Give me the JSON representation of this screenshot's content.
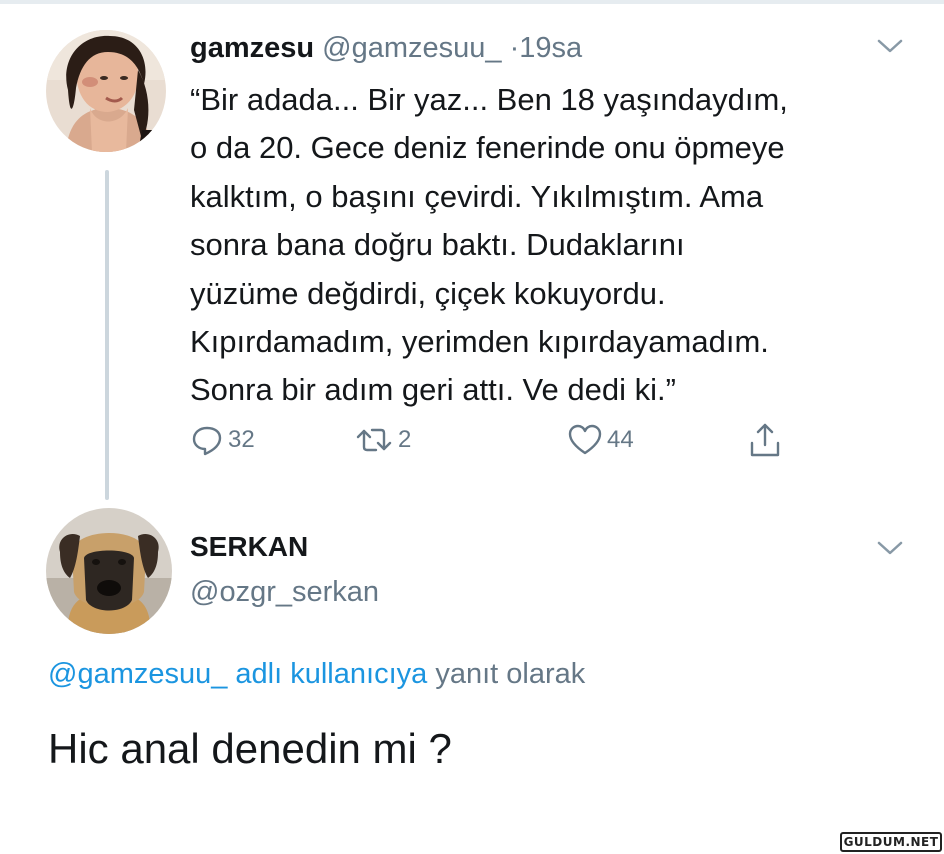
{
  "tweet1": {
    "display_name": "gamzesu",
    "handle": "@gamzesuu_",
    "separator": "·",
    "time": "19sa",
    "body_lines": [
      "“Bir adada... Bir yaz... Ben 18 yaşındaydım,",
      "o da 20. Gece deniz fenerinde onu öpmeye",
      "kalktım, o başını çevirdi. Yıkılmıştım. Ama",
      "sonra bana doğru baktı. Dudaklarını",
      "yüzüme değdirdi, çiçek kokuyordu.",
      "Kıpırdamadım, yerimden kıpırdayamadım.",
      "Sonra bir adım geri attı. Ve dedi ki.”"
    ],
    "actions": {
      "reply": {
        "icon": "reply-icon",
        "count": "32"
      },
      "retweet": {
        "icon": "retweet-icon",
        "count": "2"
      },
      "like": {
        "icon": "heart-icon",
        "count": "44"
      },
      "share": {
        "icon": "share-icon"
      }
    },
    "menu_icon": "chevron-down-icon"
  },
  "tweet2": {
    "display_name": "SERKAN",
    "handle": "@ozgr_serkan",
    "reply_to": {
      "link_text": "@gamzesuu_ adlı kullanıcıya",
      "rest_text": "yanıt olarak"
    },
    "body": "Hic anal denedin mi ?",
    "menu_icon": "chevron-down-icon"
  },
  "watermark": "GULDUM.NET",
  "colors": {
    "text": "#14171a",
    "secondary": "#657786",
    "link": "#1b95e0",
    "thread_line": "#ccd6dd"
  }
}
